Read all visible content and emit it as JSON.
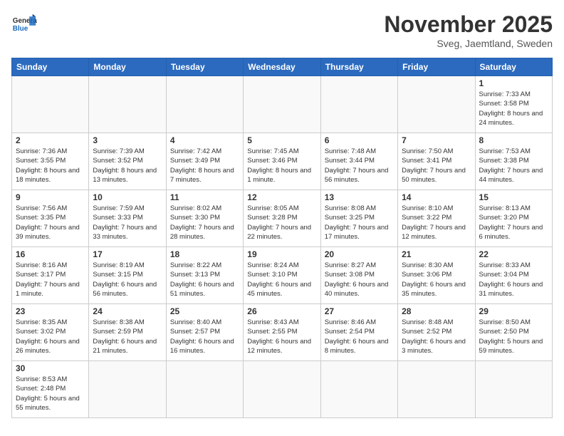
{
  "logo": {
    "general": "General",
    "blue": "Blue"
  },
  "header": {
    "month": "November 2025",
    "location": "Sveg, Jaemtland, Sweden"
  },
  "weekdays": [
    "Sunday",
    "Monday",
    "Tuesday",
    "Wednesday",
    "Thursday",
    "Friday",
    "Saturday"
  ],
  "weeks": [
    [
      {
        "day": "",
        "info": ""
      },
      {
        "day": "",
        "info": ""
      },
      {
        "day": "",
        "info": ""
      },
      {
        "day": "",
        "info": ""
      },
      {
        "day": "",
        "info": ""
      },
      {
        "day": "",
        "info": ""
      },
      {
        "day": "1",
        "info": "Sunrise: 7:33 AM\nSunset: 3:58 PM\nDaylight: 8 hours\nand 24 minutes."
      }
    ],
    [
      {
        "day": "2",
        "info": "Sunrise: 7:36 AM\nSunset: 3:55 PM\nDaylight: 8 hours\nand 18 minutes."
      },
      {
        "day": "3",
        "info": "Sunrise: 7:39 AM\nSunset: 3:52 PM\nDaylight: 8 hours\nand 13 minutes."
      },
      {
        "day": "4",
        "info": "Sunrise: 7:42 AM\nSunset: 3:49 PM\nDaylight: 8 hours\nand 7 minutes."
      },
      {
        "day": "5",
        "info": "Sunrise: 7:45 AM\nSunset: 3:46 PM\nDaylight: 8 hours\nand 1 minute."
      },
      {
        "day": "6",
        "info": "Sunrise: 7:48 AM\nSunset: 3:44 PM\nDaylight: 7 hours\nand 56 minutes."
      },
      {
        "day": "7",
        "info": "Sunrise: 7:50 AM\nSunset: 3:41 PM\nDaylight: 7 hours\nand 50 minutes."
      },
      {
        "day": "8",
        "info": "Sunrise: 7:53 AM\nSunset: 3:38 PM\nDaylight: 7 hours\nand 44 minutes."
      }
    ],
    [
      {
        "day": "9",
        "info": "Sunrise: 7:56 AM\nSunset: 3:35 PM\nDaylight: 7 hours\nand 39 minutes."
      },
      {
        "day": "10",
        "info": "Sunrise: 7:59 AM\nSunset: 3:33 PM\nDaylight: 7 hours\nand 33 minutes."
      },
      {
        "day": "11",
        "info": "Sunrise: 8:02 AM\nSunset: 3:30 PM\nDaylight: 7 hours\nand 28 minutes."
      },
      {
        "day": "12",
        "info": "Sunrise: 8:05 AM\nSunset: 3:28 PM\nDaylight: 7 hours\nand 22 minutes."
      },
      {
        "day": "13",
        "info": "Sunrise: 8:08 AM\nSunset: 3:25 PM\nDaylight: 7 hours\nand 17 minutes."
      },
      {
        "day": "14",
        "info": "Sunrise: 8:10 AM\nSunset: 3:22 PM\nDaylight: 7 hours\nand 12 minutes."
      },
      {
        "day": "15",
        "info": "Sunrise: 8:13 AM\nSunset: 3:20 PM\nDaylight: 7 hours\nand 6 minutes."
      }
    ],
    [
      {
        "day": "16",
        "info": "Sunrise: 8:16 AM\nSunset: 3:17 PM\nDaylight: 7 hours\nand 1 minute."
      },
      {
        "day": "17",
        "info": "Sunrise: 8:19 AM\nSunset: 3:15 PM\nDaylight: 6 hours\nand 56 minutes."
      },
      {
        "day": "18",
        "info": "Sunrise: 8:22 AM\nSunset: 3:13 PM\nDaylight: 6 hours\nand 51 minutes."
      },
      {
        "day": "19",
        "info": "Sunrise: 8:24 AM\nSunset: 3:10 PM\nDaylight: 6 hours\nand 45 minutes."
      },
      {
        "day": "20",
        "info": "Sunrise: 8:27 AM\nSunset: 3:08 PM\nDaylight: 6 hours\nand 40 minutes."
      },
      {
        "day": "21",
        "info": "Sunrise: 8:30 AM\nSunset: 3:06 PM\nDaylight: 6 hours\nand 35 minutes."
      },
      {
        "day": "22",
        "info": "Sunrise: 8:33 AM\nSunset: 3:04 PM\nDaylight: 6 hours\nand 31 minutes."
      }
    ],
    [
      {
        "day": "23",
        "info": "Sunrise: 8:35 AM\nSunset: 3:02 PM\nDaylight: 6 hours\nand 26 minutes."
      },
      {
        "day": "24",
        "info": "Sunrise: 8:38 AM\nSunset: 2:59 PM\nDaylight: 6 hours\nand 21 minutes."
      },
      {
        "day": "25",
        "info": "Sunrise: 8:40 AM\nSunset: 2:57 PM\nDaylight: 6 hours\nand 16 minutes."
      },
      {
        "day": "26",
        "info": "Sunrise: 8:43 AM\nSunset: 2:55 PM\nDaylight: 6 hours\nand 12 minutes."
      },
      {
        "day": "27",
        "info": "Sunrise: 8:46 AM\nSunset: 2:54 PM\nDaylight: 6 hours\nand 8 minutes."
      },
      {
        "day": "28",
        "info": "Sunrise: 8:48 AM\nSunset: 2:52 PM\nDaylight: 6 hours\nand 3 minutes."
      },
      {
        "day": "29",
        "info": "Sunrise: 8:50 AM\nSunset: 2:50 PM\nDaylight: 5 hours\nand 59 minutes."
      }
    ],
    [
      {
        "day": "30",
        "info": "Sunrise: 8:53 AM\nSunset: 2:48 PM\nDaylight: 5 hours\nand 55 minutes."
      },
      {
        "day": "",
        "info": ""
      },
      {
        "day": "",
        "info": ""
      },
      {
        "day": "",
        "info": ""
      },
      {
        "day": "",
        "info": ""
      },
      {
        "day": "",
        "info": ""
      },
      {
        "day": "",
        "info": ""
      }
    ]
  ]
}
